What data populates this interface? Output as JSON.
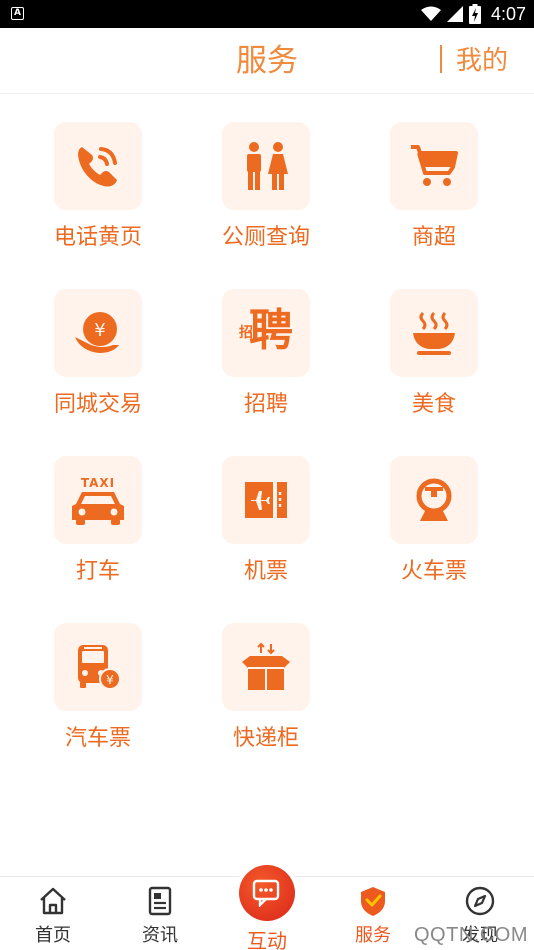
{
  "status_bar": {
    "time": "4:07",
    "notification_icon": "a-box-icon",
    "icons": [
      "wifi-icon",
      "signal-icon",
      "battery-icon"
    ]
  },
  "header": {
    "title": "服务",
    "right_link": "我的"
  },
  "services": [
    {
      "label": "电话黄页",
      "icon": "phone-icon"
    },
    {
      "label": "公厕查询",
      "icon": "restroom-icon"
    },
    {
      "label": "商超",
      "icon": "cart-icon"
    },
    {
      "label": "同城交易",
      "icon": "coin-hand-icon"
    },
    {
      "label": "招聘",
      "icon": "recruit-icon",
      "icon_text_main": "聘",
      "icon_text_small": "招"
    },
    {
      "label": "美食",
      "icon": "bowl-icon"
    },
    {
      "label": "打车",
      "icon": "taxi-icon",
      "icon_text": "TAXI"
    },
    {
      "label": "机票",
      "icon": "plane-ticket-icon"
    },
    {
      "label": "火车票",
      "icon": "train-icon"
    },
    {
      "label": "汽车票",
      "icon": "bus-icon"
    },
    {
      "label": "快递柜",
      "icon": "parcel-box-icon"
    }
  ],
  "bottom_nav": {
    "items": [
      {
        "label": "首页",
        "icon": "home-icon"
      },
      {
        "label": "资讯",
        "icon": "news-icon"
      },
      {
        "label": "互动",
        "icon": "chat-icon"
      },
      {
        "label": "服务",
        "icon": "shield-check-icon",
        "active": true
      },
      {
        "label": "发现",
        "icon": "compass-icon"
      }
    ]
  },
  "watermark": "QQTN.COM",
  "colors": {
    "accent": "#ED6A21",
    "tile_bg": "#FFF3EB",
    "active_nav": "#ED5A1F",
    "center_button": "#D9251A"
  }
}
